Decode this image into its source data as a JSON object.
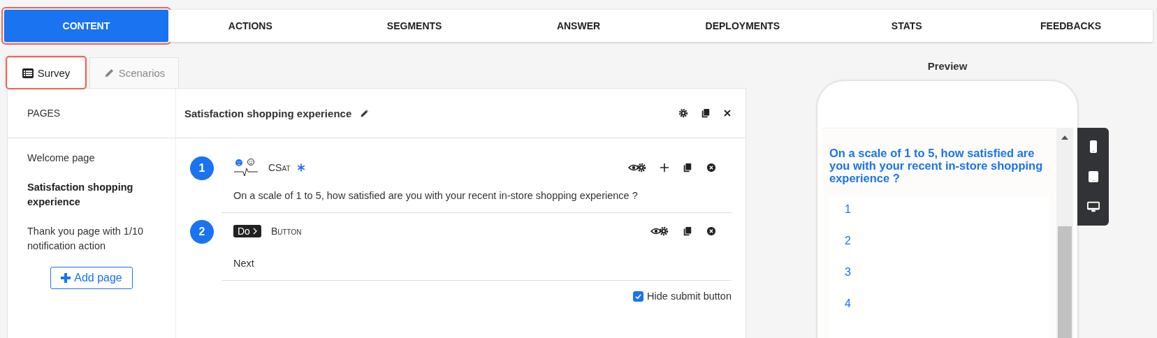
{
  "nav_tabs": [
    {
      "label": "CONTENT",
      "selected": true
    },
    {
      "label": "ACTIONS",
      "selected": false
    },
    {
      "label": "SEGMENTS",
      "selected": false
    },
    {
      "label": "ANSWER",
      "selected": false
    },
    {
      "label": "DEPLOYMENTS",
      "selected": false
    },
    {
      "label": "STATS",
      "selected": false
    },
    {
      "label": "FEEDBACKS",
      "selected": false
    }
  ],
  "sub_tabs": [
    {
      "label": "Survey",
      "kind": "survey",
      "selected": true
    },
    {
      "label": "Scenarios",
      "kind": "scenarios",
      "selected": false
    }
  ],
  "pages": {
    "heading": "PAGES",
    "items": [
      {
        "label": "Welcome page",
        "selected": false
      },
      {
        "label": "Satisfaction shopping experience",
        "selected": true
      },
      {
        "label": "Thank you page with 1/10 notification action",
        "selected": false
      }
    ],
    "add_button": "Add page"
  },
  "editor": {
    "title": "Satisfaction shopping experience",
    "questions": [
      {
        "number": "1",
        "kind": "csat",
        "type_label": "CSat",
        "required": true,
        "can_add": true,
        "text": "On a scale of 1 to 5, how satisfied are you with your recent in-store shopping experience ?"
      },
      {
        "number": "2",
        "kind": "button",
        "badge": "Do",
        "type_label": "Button",
        "required": false,
        "can_add": false,
        "text": "Next"
      }
    ],
    "hide_submit": {
      "label": "Hide submit button",
      "checked": true
    }
  },
  "preview": {
    "title": "Preview",
    "question": "On a scale of 1 to 5, how satisfied are you with your recent in-store shopping experience ?",
    "answers": [
      "1",
      "2",
      "3",
      "4"
    ]
  }
}
